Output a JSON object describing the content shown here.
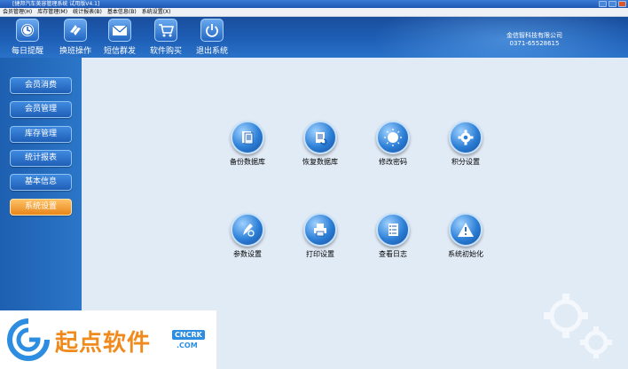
{
  "window": {
    "title": "[捷邦汽车美容管理系统 试用版V4.1]"
  },
  "menu": [
    "会员管理(H)",
    "库存管理(M)",
    "统计报表(B)",
    "基本信息(B)",
    "系统设置(X)"
  ],
  "toolbar": {
    "buttons": [
      {
        "label": "每日提醒",
        "icon": "clock-icon"
      },
      {
        "label": "换班操作",
        "icon": "swap-icon"
      },
      {
        "label": "短信群发",
        "icon": "envelope-icon"
      },
      {
        "label": "软件购买",
        "icon": "cart-icon"
      },
      {
        "label": "退出系统",
        "icon": "power-icon"
      }
    ],
    "company": {
      "name": "金信智科技有限公司",
      "phone": "0371-65528615"
    }
  },
  "sidebar": {
    "items": [
      {
        "label": "会员消费"
      },
      {
        "label": "会员管理"
      },
      {
        "label": "库存管理"
      },
      {
        "label": "统计报表"
      },
      {
        "label": "基本信息"
      },
      {
        "label": "系统设置",
        "active": true
      }
    ]
  },
  "tiles": [
    {
      "label": "备份数据库",
      "icon": "document-icon"
    },
    {
      "label": "恢复数据库",
      "icon": "restore-icon"
    },
    {
      "label": "修改密码",
      "icon": "sun-icon"
    },
    {
      "label": "积分设置",
      "icon": "gear-icon"
    },
    {
      "label": "参数设置",
      "icon": "pen-icon"
    },
    {
      "label": "打印设置",
      "icon": "printer-icon"
    },
    {
      "label": "查看日志",
      "icon": "notebook-icon"
    },
    {
      "label": "系统初始化",
      "icon": "warning-icon"
    }
  ],
  "watermark": {
    "text": "起点软件",
    "badge": "CNCRK",
    "domain": ".COM"
  },
  "colors": {
    "toolbar": "#1e5fb6",
    "sidebar_active": "#e8861a",
    "main_bg": "#e1ebf6",
    "watermark_text": "#f08a1c"
  }
}
